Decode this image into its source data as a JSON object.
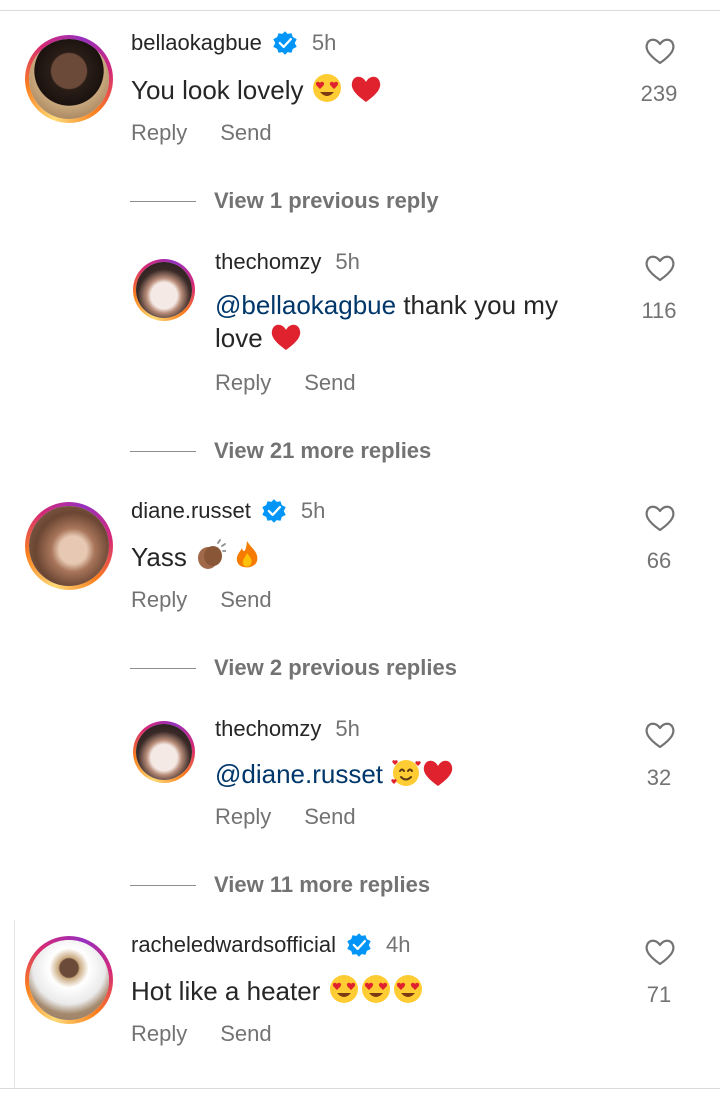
{
  "comments": [
    {
      "username": "bellaokagbue",
      "verified": true,
      "time": "5h",
      "text": "You look lovely",
      "emoji": [
        "heart-eyes",
        "red-heart"
      ],
      "likes": "239",
      "reply_label": "Reply",
      "send_label": "Send",
      "view_replies": "View 1 previous reply",
      "replies": [
        {
          "username": "thechomzy",
          "time": "5h",
          "mention": "@bellaokagbue",
          "text_line1": " thank you my",
          "text_line2": "love",
          "emoji": [
            "red-heart"
          ],
          "likes": "116",
          "reply_label": "Reply",
          "send_label": "Send"
        }
      ],
      "view_more": "View 21 more replies"
    },
    {
      "username": "diane.russet",
      "verified": true,
      "time": "5h",
      "text": "Yass",
      "emoji": [
        "clapping-hands",
        "fire"
      ],
      "likes": "66",
      "reply_label": "Reply",
      "send_label": "Send",
      "view_replies": "View 2 previous replies",
      "replies": [
        {
          "username": "thechomzy",
          "time": "5h",
          "mention": "@diane.russet",
          "emoji": [
            "smiling-face-with-hearts",
            "red-heart"
          ],
          "likes": "32",
          "reply_label": "Reply",
          "send_label": "Send"
        }
      ],
      "view_more": "View 11 more replies"
    },
    {
      "username": "racheledwardsofficial",
      "verified": true,
      "time": "4h",
      "text": "Hot like a heater",
      "emoji": [
        "heart-eyes",
        "heart-eyes",
        "heart-eyes"
      ],
      "likes": "71",
      "reply_label": "Reply",
      "send_label": "Send"
    }
  ],
  "colors": {
    "text": "#262626",
    "secondary": "#737373",
    "mention": "#00376b",
    "verified": "#0095f6",
    "heart": "#e0222f"
  }
}
